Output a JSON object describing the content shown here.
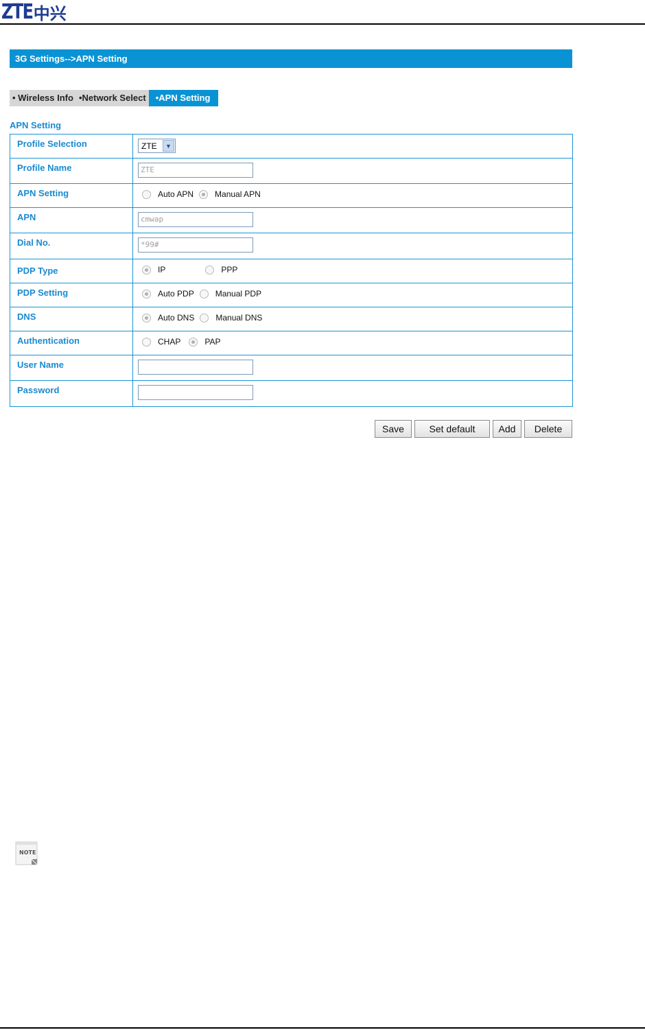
{
  "document": {
    "logo_latin": "ZTE",
    "logo_cjk": "中兴",
    "note_icon_label": "NOTE"
  },
  "page": {
    "title": "3G Settings-->APN Setting",
    "tabs": [
      {
        "label": "• Wireless Info",
        "active": false
      },
      {
        "label": "•Network Select",
        "active": false
      },
      {
        "label": "•APN Setting",
        "active": true
      }
    ],
    "section_label": "APN Setting"
  },
  "form": {
    "profile_selection": {
      "label": "Profile Selection",
      "value": "ZTE"
    },
    "profile_name": {
      "label": "Profile Name",
      "value": "ZTE"
    },
    "apn_setting": {
      "label": "APN Setting",
      "options": [
        "Auto APN",
        "Manual APN"
      ],
      "selected": "Manual APN"
    },
    "apn": {
      "label": "APN",
      "value": "cmwap"
    },
    "dial_no": {
      "label": "Dial No.",
      "value": "*99#"
    },
    "pdp_type": {
      "label": "PDP Type",
      "options": [
        "IP",
        "PPP"
      ],
      "selected": "IP"
    },
    "pdp_setting": {
      "label": "PDP Setting",
      "options": [
        "Auto PDP",
        "Manual PDP"
      ],
      "selected": "Auto PDP"
    },
    "dns": {
      "label": "DNS",
      "options": [
        "Auto DNS",
        "Manual DNS"
      ],
      "selected": "Auto DNS"
    },
    "authentication": {
      "label": "Authentication",
      "options": [
        "CHAP",
        "PAP"
      ],
      "selected": "PAP"
    },
    "user_name": {
      "label": "User Name",
      "value": ""
    },
    "password": {
      "label": "Password",
      "value": ""
    }
  },
  "buttons": {
    "save": "Save",
    "set_default": "Set default",
    "add": "Add",
    "delete": "Delete"
  },
  "colors": {
    "accent": "#0a93d4",
    "label_text": "#1a8ad0",
    "tab_inactive": "#d6d6d6"
  }
}
